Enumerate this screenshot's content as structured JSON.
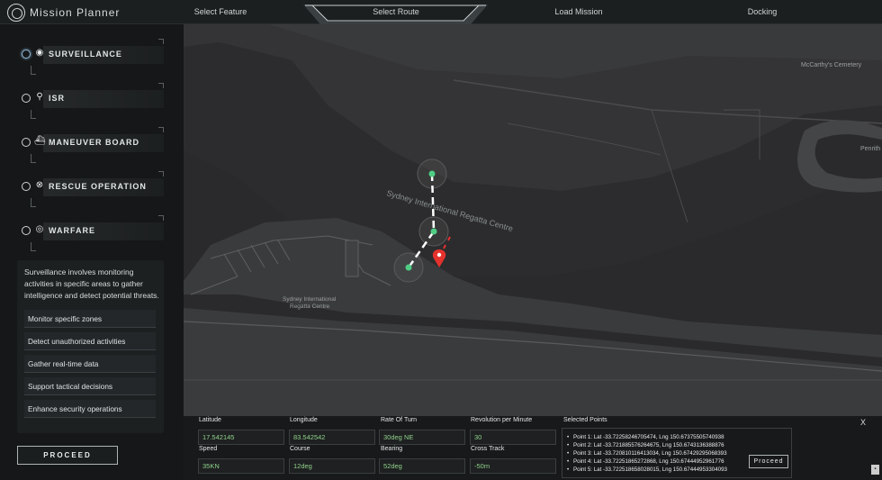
{
  "app": {
    "title": "Mission Planner"
  },
  "tabs": [
    {
      "label": "Select Feature"
    },
    {
      "label": "Select Route"
    },
    {
      "label": "Load Mission"
    },
    {
      "label": "Docking"
    }
  ],
  "active_tab": "Select Route",
  "sidebar": {
    "items": [
      {
        "label": "SURVEILLANCE",
        "icon": "eye-icon",
        "glyph": "◉"
      },
      {
        "label": "ISR",
        "icon": "search-icon",
        "glyph": "⚲"
      },
      {
        "label": "MANEUVER BOARD",
        "icon": "ship-icon",
        "glyph": "⛴"
      },
      {
        "label": "RESCUE OPERATION",
        "icon": "lifebuoy-icon",
        "glyph": "⊗"
      },
      {
        "label": "WARFARE",
        "icon": "target-icon",
        "glyph": "◎"
      }
    ],
    "selected": "SURVEILLANCE",
    "description": "Surveillance involves monitoring activities in specific areas to gather intelligence and detect potential threats.",
    "features": [
      "Monitor specific zones",
      "Detect unauthorized activities",
      "Gather real-time data",
      "Support tactical decisions",
      "Enhance security operations"
    ],
    "proceed_label": "PROCEED"
  },
  "map": {
    "labels": {
      "cemetery": "McCarthy's Cemetery",
      "regatta_main": "Sydney International Regatta Centre",
      "regatta_small_line1": "Sydney International",
      "regatta_small_line2": "Regatta Centre",
      "penrith": "Penrith"
    }
  },
  "route_panel": {
    "latitude_label": "Latitude",
    "latitude_value": "17.542145",
    "longitude_label": "Longitude",
    "longitude_value": "83.542542",
    "rate_of_turn_label": "Rate Of Turn",
    "rate_of_turn_value": "30deg NE",
    "rpm_label": "Revolution per Minute",
    "rpm_value": "30",
    "speed_label": "Speed",
    "speed_value": "35KN",
    "course_label": "Course",
    "course_value": "12deg",
    "bearing_label": "Bearing",
    "bearing_value": "52deg",
    "cross_track_label": "Cross Track",
    "cross_track_value": "-50m",
    "selected_points_title": "Selected Points",
    "points": [
      "Point 1: Lat -33.72258246705474, Lng 150.67375505740938",
      "Point 2: Lat -33.721885576264675, Lng 150.6743136388876",
      "Point 3: Lat -33.720810116413034, Lng 150.67429295068393",
      "Point 4: Lat -33.72251865272868, Lng 150.67444952961776",
      "Point 5: Lat -33.722518658028015, Lng 150.67444953304093"
    ],
    "proceed_label": "Proceed",
    "close_label": "X"
  },
  "colors": {
    "accent_active": "#8fb8d8",
    "field_value": "#8fd08a",
    "marker": "#e5322d",
    "waypoint": "#4fce84"
  }
}
